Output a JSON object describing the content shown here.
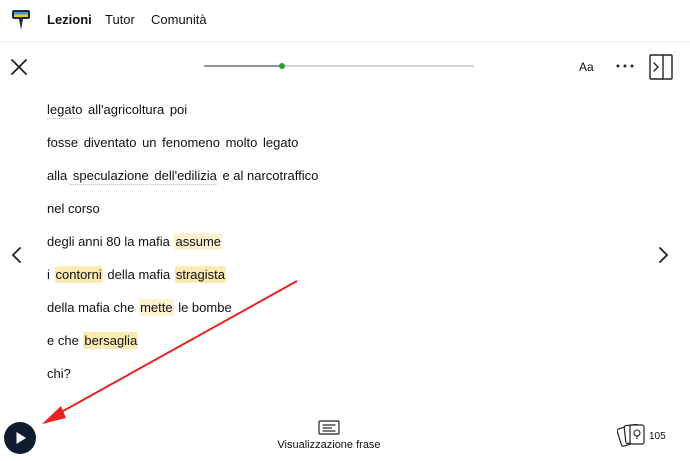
{
  "nav": {
    "items": [
      {
        "label": "Lezioni",
        "active": true
      },
      {
        "label": "Tutor",
        "active": false
      },
      {
        "label": "Comunità",
        "active": false
      }
    ]
  },
  "reader": {
    "close_icon": "close-icon",
    "progress": 0.29,
    "font_button": "Aa",
    "more_icon": "more-horizontal-icon",
    "panel_icon": "side-panel-icon"
  },
  "transcript": [
    {
      "words": [
        {
          "t": "legato",
          "s": "ul"
        },
        {
          "t": " all'agricoltura",
          "s": ""
        },
        {
          "t": " poi",
          "s": ""
        }
      ]
    },
    {
      "words": [
        {
          "t": "fosse",
          "s": ""
        },
        {
          "t": " diventato",
          "s": ""
        },
        {
          "t": " un",
          "s": ""
        },
        {
          "t": " fenomeno",
          "s": ""
        },
        {
          "t": " molto",
          "s": ""
        },
        {
          "t": " legato",
          "s": ""
        }
      ]
    },
    {
      "words": [
        {
          "t": "alla",
          "s": ""
        },
        {
          "t": " speculazione",
          "s": "ul"
        },
        {
          "t": " dell'edilizia",
          "s": "ul"
        },
        {
          "t": " e al narcotraffico",
          "s": ""
        }
      ]
    },
    {
      "words": [
        {
          "t": "nel corso",
          "s": ""
        }
      ]
    },
    {
      "words": [
        {
          "t": "degli anni 80 la mafia ",
          "s": ""
        },
        {
          "t": "assume",
          "s": "hl2"
        }
      ]
    },
    {
      "words": [
        {
          "t": "i ",
          "s": ""
        },
        {
          "t": "contorni",
          "s": "hl"
        },
        {
          "t": " della mafia ",
          "s": ""
        },
        {
          "t": "stragista",
          "s": "hl"
        }
      ]
    },
    {
      "words": [
        {
          "t": "della mafia che ",
          "s": ""
        },
        {
          "t": "mette",
          "s": "hl2"
        },
        {
          "t": " le bombe",
          "s": ""
        }
      ]
    },
    {
      "words": [
        {
          "t": "e che ",
          "s": ""
        },
        {
          "t": "bersaglia",
          "s": "hl"
        }
      ]
    },
    {
      "words": [
        {
          "t": "chi?",
          "s": ""
        }
      ]
    }
  ],
  "bottom": {
    "play_icon": "play-icon",
    "view_mode_label": "Visualizzazione frase",
    "view_mode_icon": "sentence-view-icon",
    "cards_icon": "flashcards-icon",
    "cards_count": "105"
  },
  "colors": {
    "highlight_strong": "#fbeab2",
    "highlight_light": "#fdf1cf",
    "progress_dot": "#22a33a",
    "play_bg": "#0f1b2e",
    "annotation_arrow": "#e8231f"
  }
}
